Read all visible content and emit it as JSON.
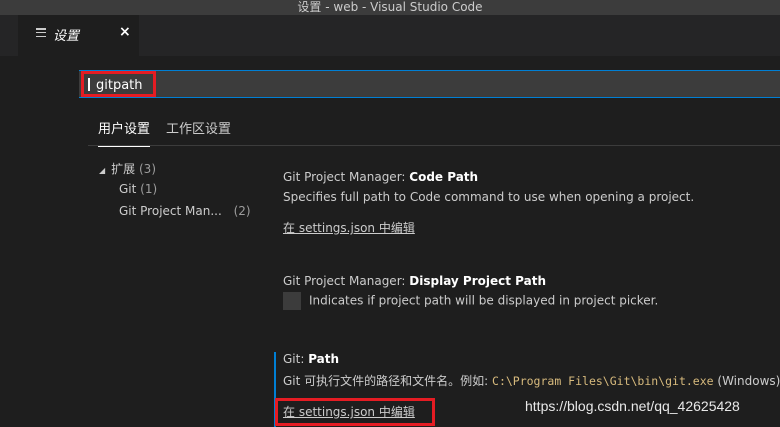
{
  "window": {
    "title": "设置 - web - Visual Studio Code"
  },
  "tab": {
    "label": "设置",
    "close": "×"
  },
  "search": {
    "value": "gitpath"
  },
  "scope_tabs": {
    "user": "用户设置",
    "workspace": "工作区设置"
  },
  "toc": {
    "group": {
      "arrow": "◢",
      "label": "扩展",
      "count": "(3)"
    },
    "items": [
      {
        "label": "Git",
        "count": "(1)"
      },
      {
        "label": "Git Project Man...",
        "count": "(2)"
      }
    ]
  },
  "settings": [
    {
      "prefix": "Git Project Manager: ",
      "name": "Code Path",
      "description": "Specifies full path to Code command to use when opening a project.",
      "link": "在 settings.json 中编辑"
    },
    {
      "prefix": "Git Project Manager: ",
      "name": "Display Project Path",
      "description": "Indicates if project path will be displayed in project picker."
    },
    {
      "prefix": "Git: ",
      "name": "Path",
      "description_pre": "Git 可执行文件的路径和文件名。例如: ",
      "description_code": "C:\\Program Files\\Git\\bin\\git.exe",
      "description_post": " (Windows)",
      "link": "在 settings.json 中编辑"
    }
  ],
  "watermark": "https://blog.csdn.net/qq_42625428",
  "colors": {
    "editor_bg": "#1e1e1e",
    "highlight_red": "#e51c23",
    "focus_blue": "#007fd4"
  }
}
